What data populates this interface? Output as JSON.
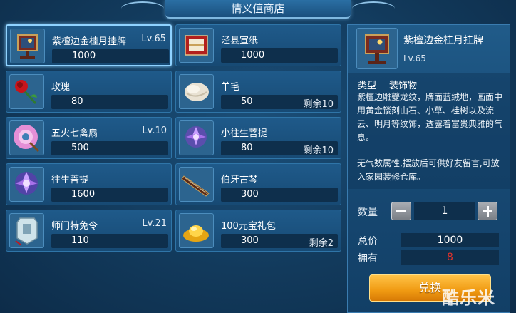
{
  "shop_title": "情义值商店",
  "items": [
    {
      "name": "紫檀边金桂月挂牌",
      "level": "Lv.65",
      "price": "1000",
      "remain": "",
      "icon": "plaque-icon",
      "selected": true
    },
    {
      "name": "泾县宣纸",
      "level": "",
      "price": "1000",
      "remain": "",
      "icon": "paper-box-icon"
    },
    {
      "name": "玫瑰",
      "level": "",
      "price": "80",
      "remain": "",
      "icon": "rose-icon"
    },
    {
      "name": "羊毛",
      "level": "",
      "price": "50",
      "remain": "剩余10",
      "icon": "wool-icon"
    },
    {
      "name": "五火七禽扇",
      "level": "Lv.10",
      "price": "500",
      "remain": "",
      "icon": "feather-fan-icon"
    },
    {
      "name": "小往生菩提",
      "level": "",
      "price": "80",
      "remain": "剩余10",
      "icon": "lotus-small-icon"
    },
    {
      "name": "往生菩提",
      "level": "",
      "price": "1600",
      "remain": "",
      "icon": "lotus-icon"
    },
    {
      "name": "伯牙古琴",
      "level": "",
      "price": "300",
      "remain": "",
      "icon": "guqin-icon"
    },
    {
      "name": "师门特免令",
      "level": "Lv.21",
      "price": "110",
      "remain": "",
      "icon": "token-icon"
    },
    {
      "name": "100元宝礼包",
      "level": "",
      "price": "300",
      "remain": "剩余2",
      "icon": "gold-ingot-icon"
    }
  ],
  "detail": {
    "name": "紫檀边金桂月挂牌",
    "level": "Lv.65",
    "type_label": "类型",
    "type_value": "装饰物",
    "description": "紫檀边雕夔龙纹，牌面蓝绒地，画面中用黄金镂刻山石、小草、桂树以及流云、明月等纹饰，透露着富贵典雅的气息。",
    "note": "无气数属性,摆放后可供好友留言,可放入家园装修仓库。"
  },
  "purchase": {
    "quantity_label": "数量",
    "quantity": "1",
    "total_label": "总价",
    "total": "1000",
    "owned_label": "拥有",
    "owned": "8",
    "exchange_label": "兑换"
  },
  "colors": {
    "owned_value": "#e0322b",
    "accent_gold": "#f5a623"
  },
  "watermark": "酷乐米"
}
